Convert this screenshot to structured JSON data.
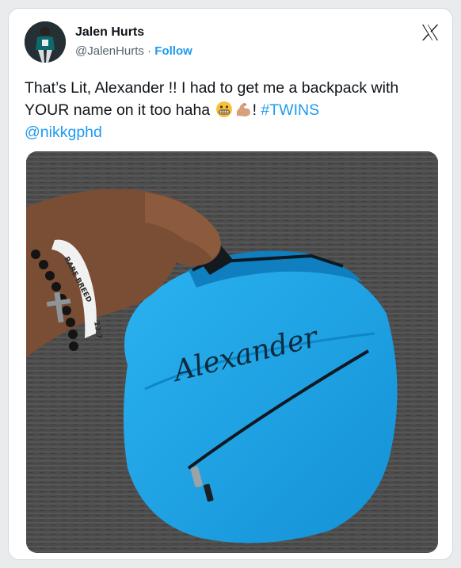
{
  "author": {
    "name": "Jalen Hurts",
    "handle": "@JalenHurts",
    "separator": "·",
    "follow_label": "Follow"
  },
  "tweet": {
    "text_part1": "That’s Lit, Alexander !! I had to get me a backpack with YOUR name on it too haha",
    "text_part2": "!",
    "hashtag": "#TWINS",
    "mention": "@nikkgphd",
    "emojis": [
      "grimacing-face-emoji",
      "flexed-biceps-emoji"
    ]
  },
  "photo": {
    "backpack_text": "Alexander",
    "wristband_text": "RARE BREED",
    "wristband_number": "13:7"
  },
  "colors": {
    "link": "#1d9bf0",
    "backpack": "#1aa3e6",
    "text": "#0f1419",
    "secondary": "#536471"
  }
}
